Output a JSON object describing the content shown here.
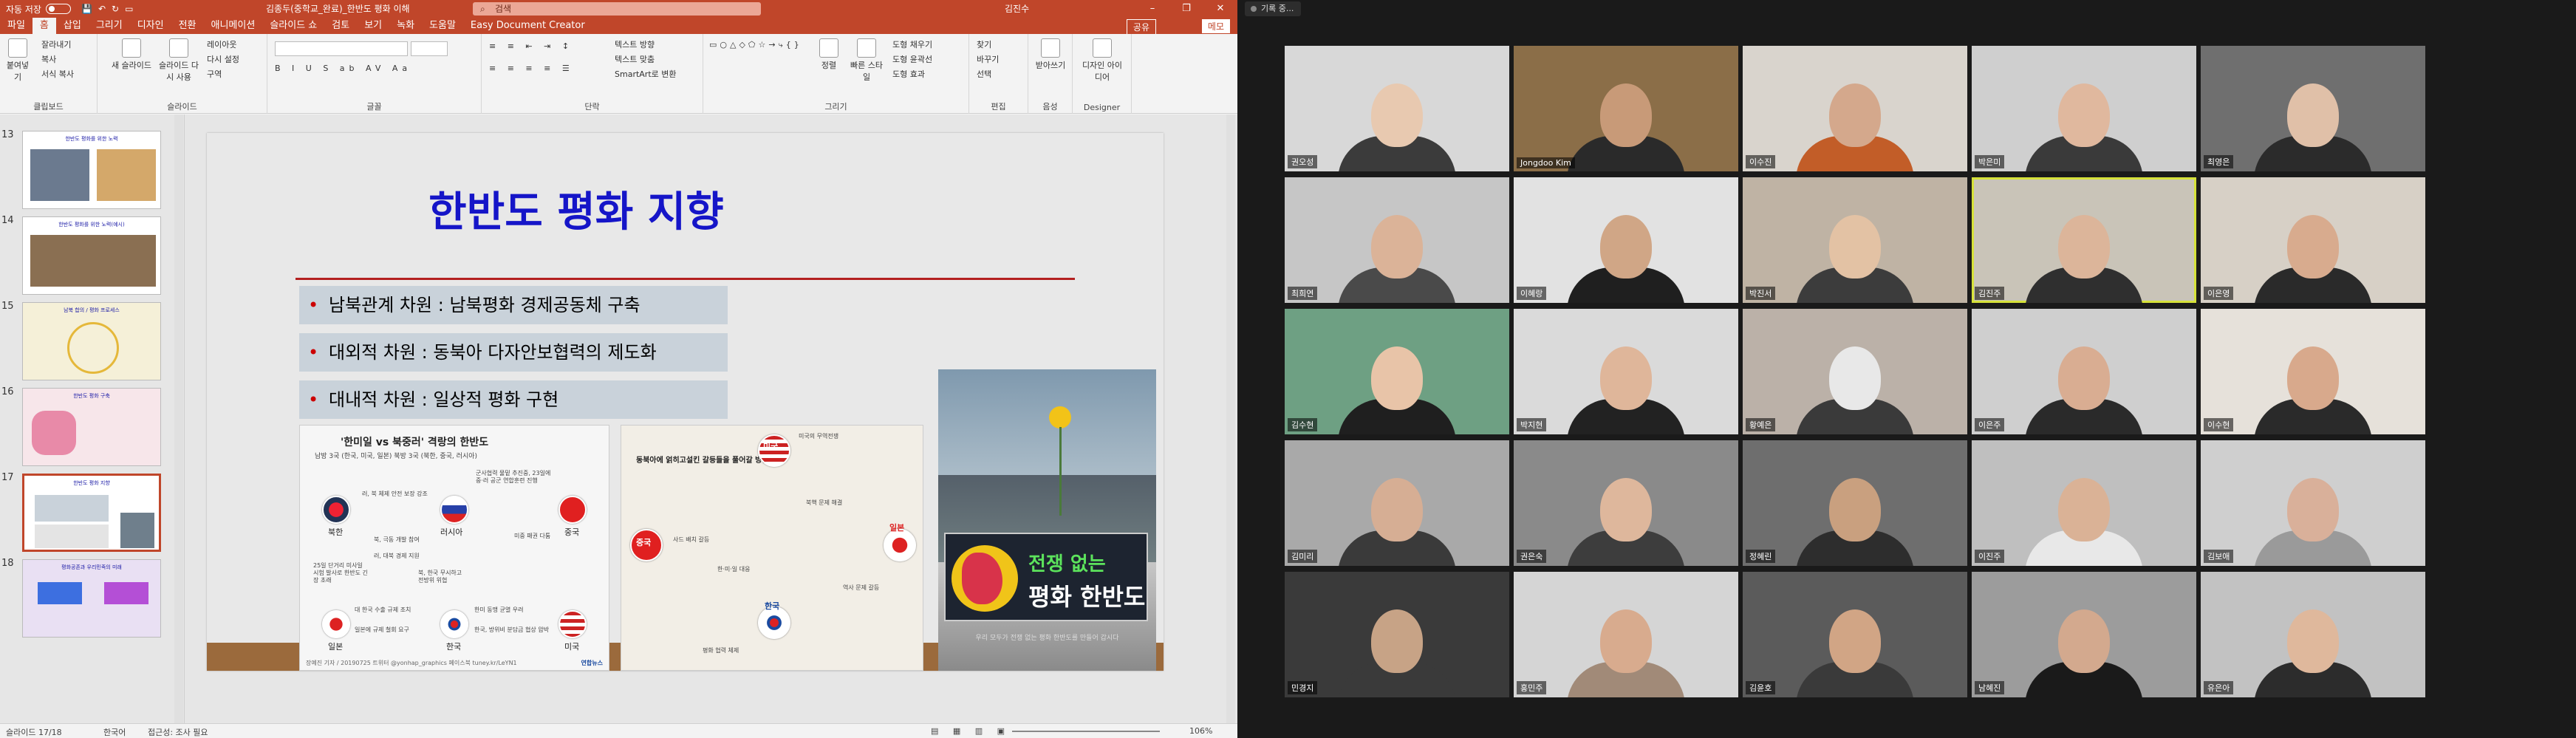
{
  "ppt": {
    "titlebar": {
      "autosave_label": "자동 저장",
      "toggle_state": "끔",
      "doc_title": "김종두(중학교_완료)_한반도 평화 이해",
      "search_placeholder": "검색",
      "user": "김진수",
      "minimize": "–",
      "restore": "❐",
      "close": "✕"
    },
    "tabs": [
      "파일",
      "홈",
      "삽입",
      "그리기",
      "디자인",
      "전환",
      "애니메이션",
      "슬라이드 쇼",
      "검토",
      "보기",
      "녹화",
      "도움말",
      "Easy Document Creator"
    ],
    "active_tab": 1,
    "share_label": "공유",
    "memo_label": "메모",
    "ribbon": {
      "groups": [
        "클립보드",
        "슬라이드",
        "글꼴",
        "단락",
        "그리기",
        "편집",
        "음성",
        "Designer"
      ],
      "paste": "붙여넣기",
      "cut": "잘라내기",
      "copy": "복사",
      "format_copy": "서식 복사",
      "new_slide": "새 슬라이드",
      "reuse_slide": "슬라이드 다시 사용",
      "layout": "레이아웃",
      "reset": "다시 설정",
      "section": "구역",
      "text_direction": "텍스트 방향",
      "align_text": "텍스트 맞춤",
      "smartart": "SmartArt로 변환",
      "arrange": "정렬",
      "quick_styles": "빠른 스타일",
      "shape_fill": "도형 채우기",
      "shape_outline": "도형 윤곽선",
      "shape_effects": "도형 효과",
      "find": "찾기",
      "replace": "바꾸기",
      "select": "선택",
      "dictate": "받아쓰기",
      "designer": "디자인 아이디어"
    },
    "slide_numbers": [
      "13",
      "14",
      "15",
      "16",
      "17",
      "18"
    ],
    "active_slide_index": 4,
    "thumb_titles": [
      "한반도 평화를 위한 노력",
      "한반도 평화를 위한 노력(예시)",
      "남북 합의 / 평화 프로세스",
      "한반도 평화 구축",
      "한반도 평화 지향",
      "평화공존과 우리민족의 미래"
    ],
    "slide": {
      "title": "한반도 평화 지향",
      "bullets": [
        "남북관계 차원 : 남북평화 경제공동체 구축",
        "대외적 차원 : 동북아 다자안보협력의 제도화",
        "대내적 차원 : 일상적 평화 구현"
      ],
      "infographic1": {
        "title": "'한미일 vs 북중러' 격랑의 한반도",
        "legend": "남방 3국 (한국, 미국, 일본)   북방 3국 (북한, 중국, 러시아)",
        "countries": [
          "북한",
          "러시아",
          "중국",
          "일본",
          "한국",
          "미국"
        ],
        "notes": [
          "러, 북 체제 안전 보장 강조",
          "군사협력 물밑 추진중, 23일에 중·러 공군 연합훈련 진행",
          "북, 극동 개발 참여",
          "러, 대북 경제 지원",
          "미중 패권 다툼",
          "북, 한국 무시하고 전방위 위협",
          "25일 단거리 미사일 시험 발사로 한반도 긴장 초래",
          "대 한국 수출 규제 조치",
          "일본에 규제 철회 요구",
          "한미 동맹 균열 우려",
          "한국, 방위비 분담금 협상 압박"
        ],
        "credit": "장예진 기자 / 20190725 트위터 @yonhap_graphics 페이스북 tuney.kr/LeYN1",
        "source": "연합뉴스"
      },
      "infographic2": {
        "title": "동북아에 얽히고설킨 갈등들을 풀어갈 방법",
        "countries": [
          "미국",
          "중국",
          "일본",
          "한국"
        ],
        "notes": [
          "미국의 무역전쟁",
          "사드 배치 갈등",
          "북핵 문제 해결",
          "한·미·일 대응",
          "역사 문제 갈등",
          "평화 협력 체제"
        ]
      },
      "photo_badge_line1": "전쟁 없는",
      "photo_badge_line2": "평화 한반도",
      "photo_caption": "우리 모두가 전쟁 없는 평화 한반도를 만들어 갑시다"
    },
    "status": {
      "slide_counter": "슬라이드 17/18",
      "language": "한국어",
      "accessibility": "접근성: 조사 필요",
      "zoom": "106%"
    }
  },
  "zoom": {
    "record_label": "기록 중...",
    "participants": [
      "권오성",
      "Jongdoo Kim",
      "이수진",
      "박은미",
      "최영은",
      "최희연",
      "이혜랑",
      "박진서",
      "김진주",
      "이은영",
      "김수현",
      "박지현",
      "황예은",
      "이은주",
      "이수현",
      "김미리",
      "권은숙",
      "정혜린",
      "이진주",
      "김보애",
      "민경지",
      "홍민주",
      "김윤호",
      "남혜진",
      "유은아"
    ],
    "speaking_index": 8
  }
}
